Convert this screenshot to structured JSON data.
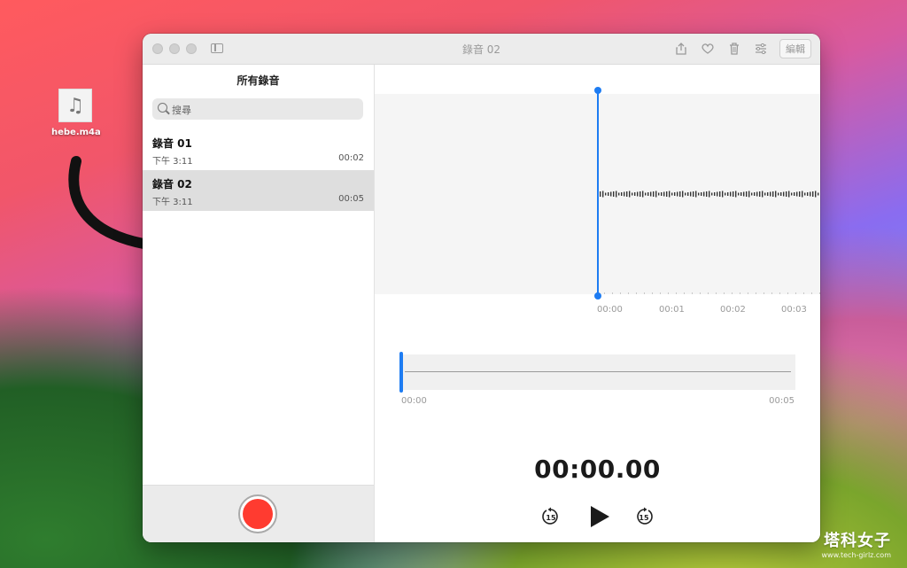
{
  "desktop": {
    "file_name": "hebe.m4a",
    "file_icon": "music-note-icon"
  },
  "window": {
    "title": "錄音 02",
    "toolbar": {
      "share_icon": "share-icon",
      "favorite_icon": "heart-icon",
      "delete_icon": "trash-icon",
      "options_icon": "sliders-icon",
      "edit_label": "編輯"
    }
  },
  "sidebar": {
    "title": "所有錄音",
    "search_placeholder": "搜尋",
    "recordings": [
      {
        "name": "錄音 01",
        "time": "下午 3:11",
        "duration": "00:02",
        "selected": false
      },
      {
        "name": "錄音 02",
        "time": "下午 3:11",
        "duration": "00:05",
        "selected": true
      }
    ],
    "record_button_icon": "record-icon"
  },
  "main": {
    "timeline_ticks": [
      "00:00",
      "00:01",
      "00:02",
      "00:03"
    ],
    "overview_start": "00:00",
    "overview_end": "00:05",
    "timer": "00:00.00",
    "controls": {
      "skip_back_label": "15",
      "skip_forward_label": "15"
    }
  },
  "watermark": {
    "main": "塔科女子",
    "sub": "www.tech-girlz.com"
  },
  "colors": {
    "accent": "#1e7cf2",
    "record": "#ff3b30"
  }
}
